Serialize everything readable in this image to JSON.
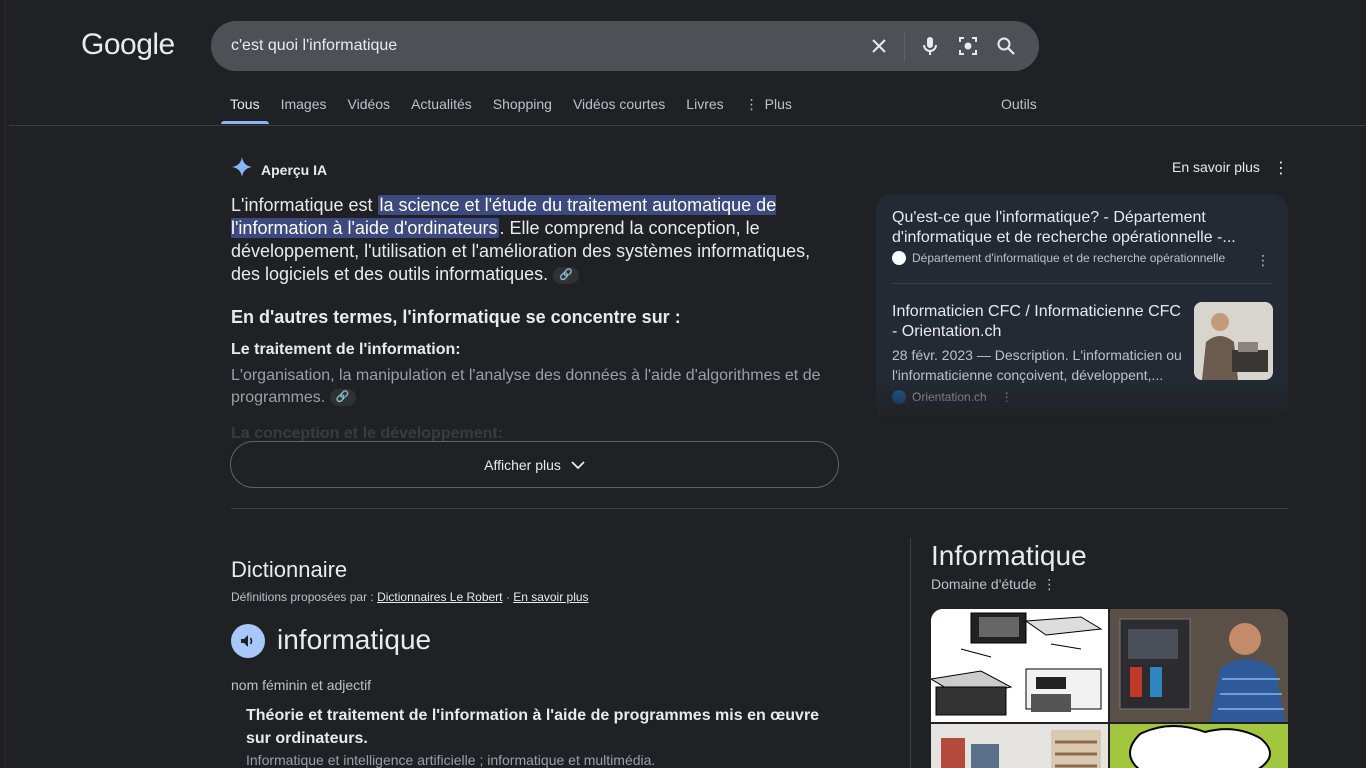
{
  "header": {
    "logo": "Google",
    "search_value": "c'est quoi l'informatique"
  },
  "tabs": [
    {
      "label": "Tous",
      "active": true
    },
    {
      "label": "Images"
    },
    {
      "label": "Vidéos"
    },
    {
      "label": "Actualités"
    },
    {
      "label": "Shopping"
    },
    {
      "label": "Vidéos courtes"
    },
    {
      "label": "Livres"
    },
    {
      "label": "Plus"
    }
  ],
  "tools_label": "Outils",
  "ai_overview": {
    "title": "Aperçu IA",
    "learn_more": "En savoir plus",
    "para_start": "L'informatique est ",
    "para_highlight": "la science et l'étude du traitement automatique de l'information à l'aide d'ordinateurs",
    "para_end": ". Elle comprend la conception, le développement, l'utilisation et l'amélioration des systèmes informatiques, des logiciels et des outils informatiques.",
    "subheading": "En d'autres termes, l'informatique se concentre sur :",
    "point_title": "Le traitement de l'information:",
    "point_body": "L'organisation, la manipulation et l'analyse des données à l'aide d'algorithmes et de programmes.",
    "faded_text": "La conception et le développement:",
    "show_more": "Afficher plus"
  },
  "sources": [
    {
      "title": "Qu'est-ce que l'informatique? - Département d'informatique et de recherche opérationnelle -...",
      "site": "Département d'informatique et de recherche opérationnelle"
    },
    {
      "title": "Informaticien CFC / Informaticienne CFC - Orientation.ch",
      "snippet": "28 févr. 2023 — Description. L'informaticien ou l'informaticienne conçoivent, développent,...",
      "site": "Orientation.ch"
    }
  ],
  "dictionary": {
    "title": "Dictionnaire",
    "defs_prefix": "Définitions proposées par :",
    "defs_source": "Dictionnaires Le Robert",
    "defs_sep": "·",
    "defs_more": "En savoir plus",
    "word": "informatique",
    "pos": "nom féminin et adjectif",
    "definition": "Théorie et traitement de l'information à l'aide de programmes mis en œuvre sur ordinateurs.",
    "example": "Informatique et intelligence artificielle ; informatique et multimédia."
  },
  "knowledge_panel": {
    "title": "Informatique",
    "subtitle": "Domaine d'étude"
  },
  "colors": {
    "background": "#202124",
    "search_bg": "#4d5156",
    "accent": "#8ab4f8",
    "highlight": "#3c4a80"
  }
}
